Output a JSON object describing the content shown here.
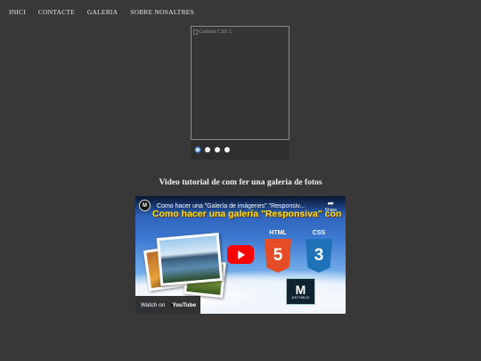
{
  "nav": {
    "items": [
      "INICI",
      "CONTACTE",
      "GALERIA",
      "SOBRE NOSALTRES"
    ]
  },
  "gallery": {
    "broken_image_alt": "Galeria CSS 1",
    "dot_count": 4,
    "active_dot": 1
  },
  "section": {
    "title": "Video tutorial de com fer una galeria de fotos"
  },
  "video": {
    "channel_initial": "M",
    "title": "Como hacer una \"Galería de imágenes\" \"Responsiv...",
    "share_label": "Share",
    "overlay_text": "Como hacer una galería \"Responsiva\" con",
    "html_label": "HTML",
    "html_shield": "5",
    "css_label": "CSS",
    "css_shield": "3",
    "logo_letter": "M",
    "logo_text": "ASTIMUS",
    "watch_on": "Watch on",
    "youtube": "YouTube",
    "colors": {
      "play": "#ff0000",
      "html": "#e44d26",
      "css": "#1f72b8",
      "overlay_text": "#f7e51c"
    }
  }
}
